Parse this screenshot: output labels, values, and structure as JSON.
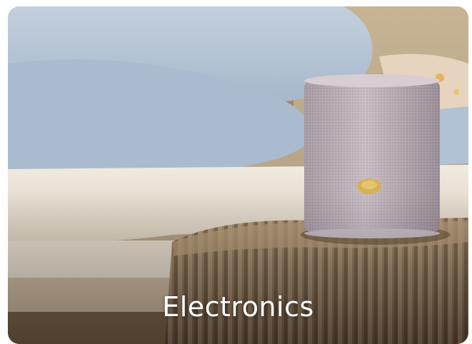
{
  "category_card": {
    "label": "Electronics",
    "image": "speaker-on-folded-paper-stool",
    "colors": {
      "text": "#ffffff",
      "wall": "#b8a68a",
      "blanket": "#b4c4d6",
      "cushion": "#e9e2d6",
      "speaker": "#b6aab2",
      "stool": "#8f765a",
      "button": "#d6b254"
    }
  }
}
